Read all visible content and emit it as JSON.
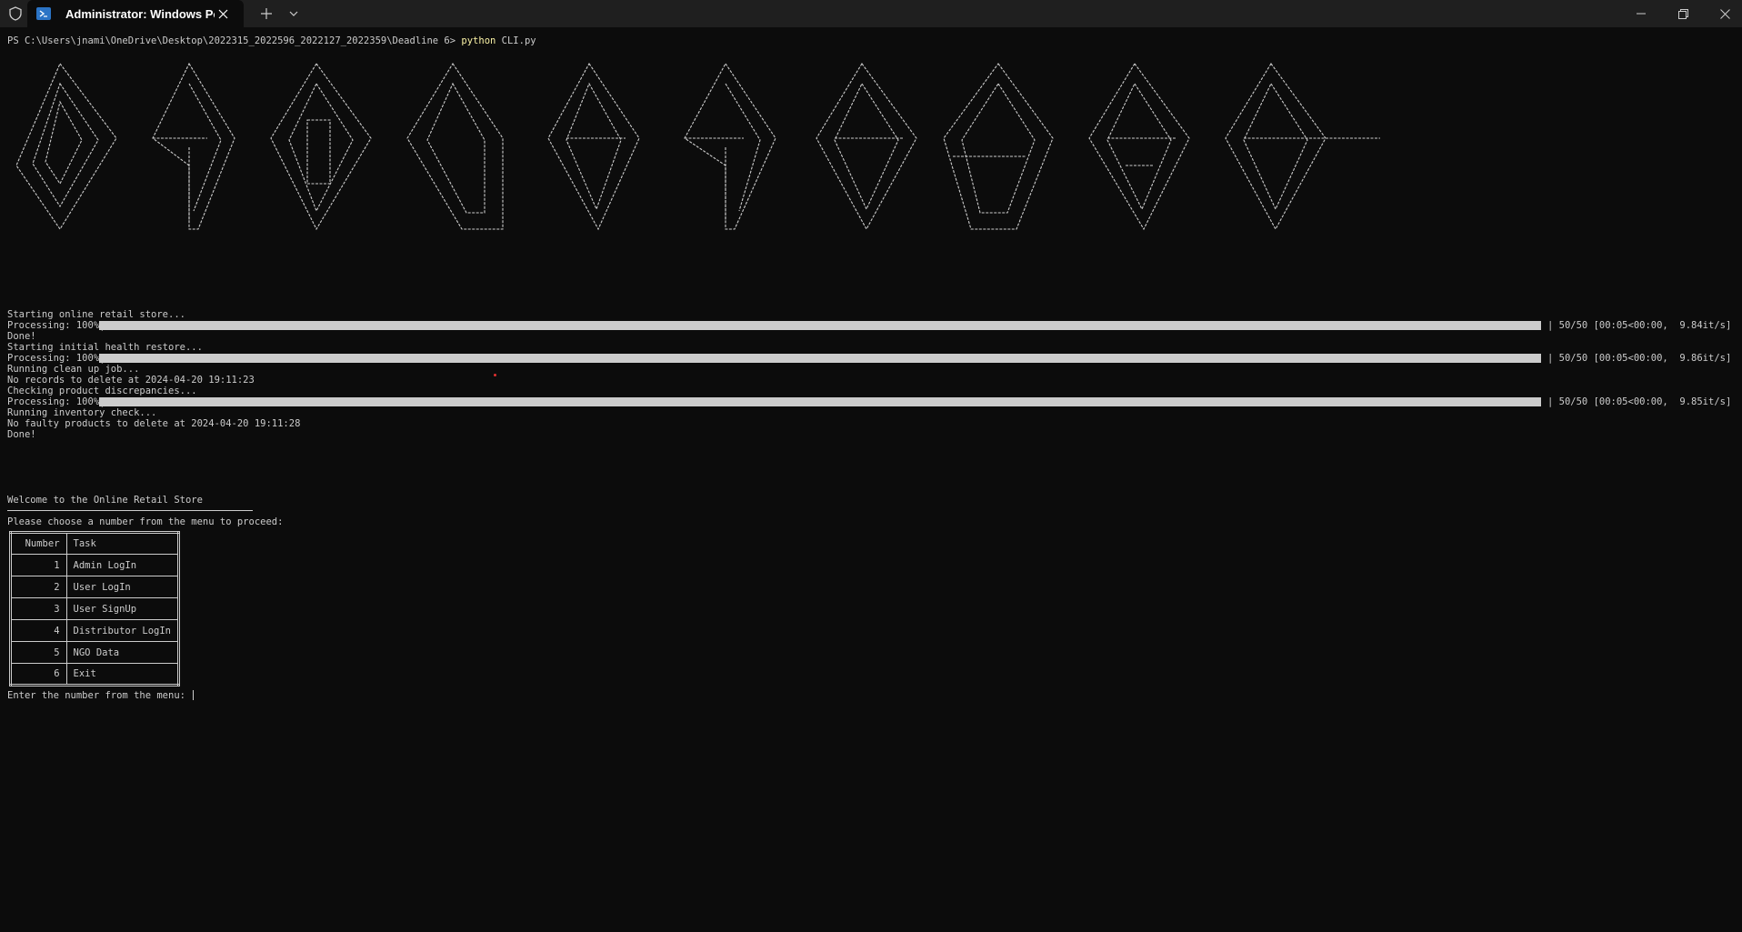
{
  "window": {
    "tab_title": "Administrator: Windows PowerShell",
    "icons": {
      "shield": "shield-icon",
      "tab": "powershell-icon",
      "close_tab": "close-icon",
      "new_tab": "plus-icon",
      "dropdown": "chevron-down-icon",
      "minimize": "minimize-icon",
      "maximize": "restore-icon",
      "close": "close-icon"
    }
  },
  "terminal": {
    "prompt": "PS C:\\Users\\jnami\\OneDrive\\Desktop\\2022315_2022596_2022127_2022359\\Deadline 6> ",
    "command": "python",
    "command_arg": " CLI.py",
    "log": [
      "Starting online retail store...",
      "Done!",
      "Starting initial health restore...",
      "Running clean up job...",
      "No records to delete at 2024-04-20 19:11:23",
      "Checking product discrepancies...",
      "Running inventory check...",
      "No faulty products to delete at 2024-04-20 19:11:28",
      "Done!"
    ],
    "progress": [
      {
        "label": "Processing: 100%|",
        "fraction": 1.0,
        "stats": "| 50/50 [00:05<00:00,  9.84it/s]"
      },
      {
        "label": "Processing: 100%|",
        "fraction": 1.0,
        "stats": "| 50/50 [00:05<00:00,  9.86it/s]"
      },
      {
        "label": "Processing: 100%|",
        "fraction": 1.0,
        "stats": "| 50/50 [00:05<00:00,  9.85it/s]"
      }
    ],
    "welcome": "Welcome to the Online Retail Store",
    "instruction": "Please choose a number from the menu to proceed:",
    "menu": {
      "headers": [
        "Number",
        "Task"
      ],
      "rows": [
        {
          "number": "1",
          "task": "Admin LogIn"
        },
        {
          "number": "2",
          "task": "User LogIn"
        },
        {
          "number": "3",
          "task": "User SignUp"
        },
        {
          "number": "4",
          "task": "Distributor LogIn"
        },
        {
          "number": "5",
          "task": "NGO Data"
        },
        {
          "number": "6",
          "task": "Exit"
        }
      ]
    },
    "input_prompt": "Enter the number from the menu: "
  },
  "colors": {
    "background": "#0c0c0c",
    "titlebar": "#1f1f1f",
    "text": "#cccccc",
    "command_highlight": "#f9f1a5",
    "tab_icon": "#2b74c6"
  }
}
